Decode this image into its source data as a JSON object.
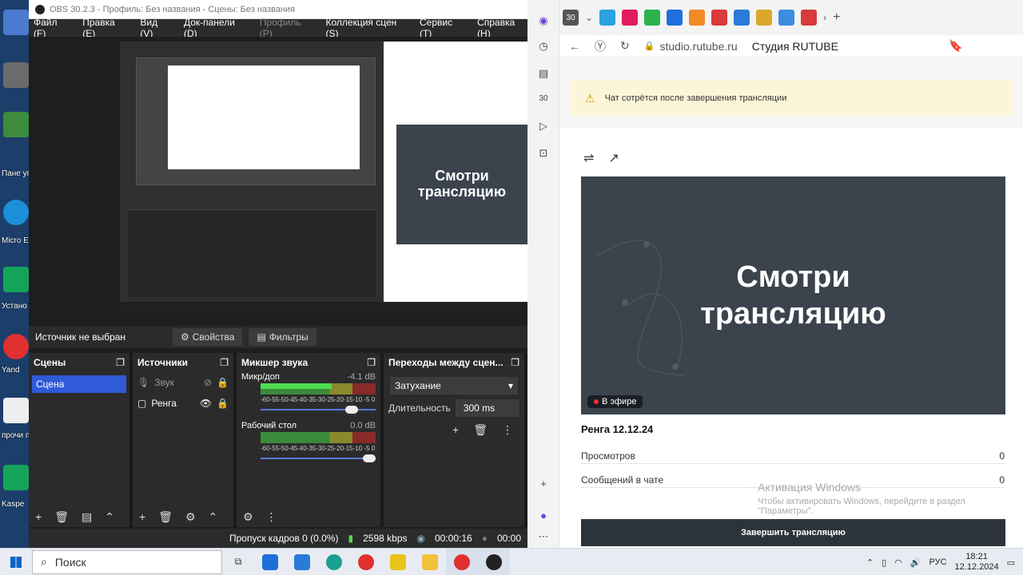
{
  "desktop": {
    "labels": [
      "Пане управл",
      "Micro Edg",
      "Устано Kaspe",
      "Yand",
      "прочи перед",
      "Kaspe"
    ]
  },
  "obs": {
    "title": "OBS 30.2.3 - Профиль: Без названия - Сцены: Без названия",
    "menu": [
      "Файл (F)",
      "Правка (E)",
      "Вид (V)",
      "Док-панели (D)",
      "Профиль (P)",
      "Коллекция сцен (S)",
      "Сервис (T)",
      "Справка (H)"
    ],
    "preview_card_text": "Смотри трансляцию",
    "source_none": "Источник не выбран",
    "properties_btn": "Свойства",
    "filters_btn": "Фильтры",
    "scenes": {
      "title": "Сцены",
      "items": [
        "Сцена"
      ]
    },
    "sources": {
      "title": "Источники",
      "items": [
        "Звук",
        "Ренга"
      ]
    },
    "mixer": {
      "title": "Микшер звука",
      "channels": [
        {
          "name": "Микр/доп",
          "db": "-4.1 dB",
          "level": 0.62,
          "volume": 0.85
        },
        {
          "name": "Рабочий стол",
          "db": "0.0 dB",
          "level": 0.0,
          "volume": 1.0
        }
      ],
      "scale": "-60-55-50-45-40-35-30-25-20-15-10 -5 0"
    },
    "transitions": {
      "title": "Переходы между сцен...",
      "selected": "Затухание",
      "duration_label": "Длительность",
      "duration_value": "300 ms"
    },
    "status": {
      "dropped": "Пропуск кадров 0 (0.0%)",
      "bitrate": "2598 kbps",
      "live_time": "00:00:16",
      "rec_time": "00:00"
    }
  },
  "browser": {
    "tab_count": "30",
    "domain": "studio.rutube.ru",
    "page_title": "Студия RUTUBE",
    "warning": "Чат сотрётся после завершения трансляции",
    "player_text_line1": "Смотри",
    "player_text_line2": "трансляцию",
    "live_badge": "В эфире",
    "stream_name": "Ренга 12.12.24",
    "stats": [
      {
        "label": "Просмотров",
        "value": "0"
      },
      {
        "label": "Сообщений в чате",
        "value": "0"
      }
    ],
    "windows_activation_title": "Активация Windows",
    "windows_activation_text": "Чтобы активировать Windows, перейдите в раздел \"Параметры\".",
    "end_button": "Завершить трансляцию"
  },
  "taskbar": {
    "search_placeholder": "Поиск",
    "lang": "РУС",
    "time": "18:21",
    "date": "12.12.2024"
  }
}
